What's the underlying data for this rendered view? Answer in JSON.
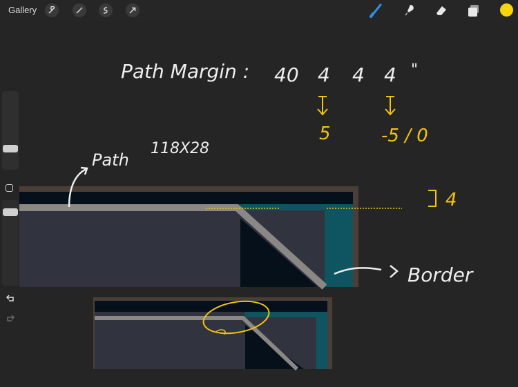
{
  "toolbar": {
    "gallery_label": "Gallery",
    "left_tools": [
      "wrench-icon",
      "magic-wand-icon",
      "selection-icon",
      "transform-icon"
    ],
    "right_tools": [
      "brush-icon",
      "smudge-icon",
      "eraser-icon",
      "layers-icon"
    ],
    "active_tool": "brush-icon",
    "accent_color": "#2f8fe8",
    "current_color": "#f7d50c"
  },
  "canvas": {
    "background": "#252525",
    "annotations": {
      "path_margin_label": "Path Margin :",
      "margin_values": [
        "40",
        "4",
        "4",
        "4",
        "\""
      ],
      "change_first": "5",
      "change_second": "-5 / 0",
      "path_label": "Path",
      "path_size": "118X28",
      "border_label": "Border",
      "bracket_value": "4"
    },
    "colors": {
      "ink_white": "#eeeeee",
      "ink_yellow": "#f2c40f",
      "frame_brown": "#4a3f37",
      "navy": "#05101a",
      "teal": "#0e5461",
      "fill_slate": "#31343f",
      "path_gray": "#8a8784"
    }
  }
}
